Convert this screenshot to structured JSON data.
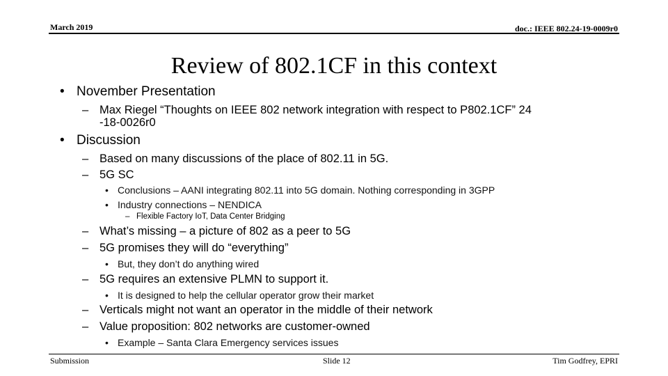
{
  "header": {
    "date": "March 2019",
    "doc_id": "doc.: IEEE 802.24-19-0009r0"
  },
  "slide": {
    "title": "Review of 802.1CF in this context",
    "bullets": [
      {
        "level": 1,
        "marker": "•",
        "text": "November Presentation"
      },
      {
        "level": 2,
        "marker": "–",
        "text": "Max Riegel  “Thoughts on IEEE 802 network integration with respect to P802.1CF”  24",
        "continuation": "-18-0026r0"
      },
      {
        "level": 1,
        "marker": "•",
        "text": "Discussion"
      },
      {
        "level": 2,
        "marker": "–",
        "text": "Based on many discussions of the place of 802.11 in 5G."
      },
      {
        "level": 2,
        "marker": "–",
        "text": "5G SC"
      },
      {
        "level": 3,
        "marker": "•",
        "text": "Conclusions – AANI integrating 802.11 into 5G domain.  Nothing corresponding in 3GPP"
      },
      {
        "level": 3,
        "marker": "•",
        "text": "Industry connections – NENDICA"
      },
      {
        "level": 4,
        "marker": "–",
        "text": "Flexible Factory IoT, Data Center Bridging"
      },
      {
        "level": 2,
        "marker": "–",
        "text": "What’s missing – a picture of 802 as a peer to 5G"
      },
      {
        "level": 2,
        "marker": "–",
        "text": "5G promises they will do “everything”"
      },
      {
        "level": 3,
        "marker": "•",
        "text": "But, they don’t do anything wired"
      },
      {
        "level": 2,
        "marker": "–",
        "text": "5G requires an extensive PLMN to support it."
      },
      {
        "level": 3,
        "marker": "•",
        "text": "It is designed to help the cellular operator grow their market"
      },
      {
        "level": 2,
        "marker": "–",
        "text": "Verticals might not want an operator in the middle of their network"
      },
      {
        "level": 2,
        "marker": "–",
        "text": "Value proposition: 802 networks are customer-owned"
      },
      {
        "level": 3,
        "marker": "•",
        "text": "Example – Santa Clara Emergency services issues"
      }
    ]
  },
  "footer": {
    "left": "Submission",
    "center": "Slide 12",
    "right": "Tim Godfrey, EPRI"
  }
}
